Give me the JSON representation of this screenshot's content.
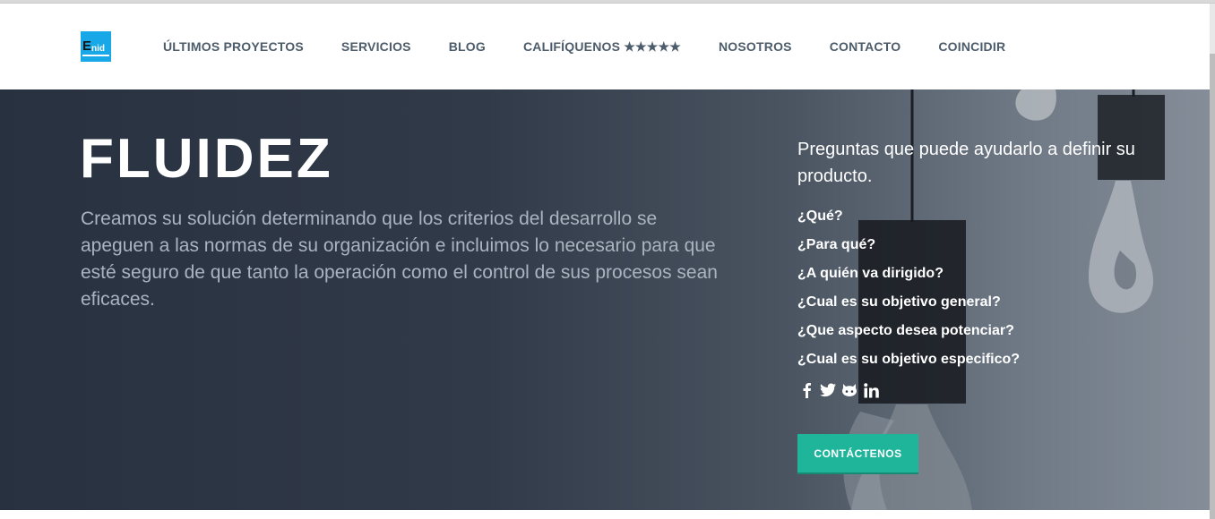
{
  "brand": {
    "logo_big": "E",
    "logo_small": "nid",
    "logo_color": "#18a8e8"
  },
  "nav": {
    "items": [
      {
        "label": "ÚLTIMOS PROYECTOS"
      },
      {
        "label": "SERVICIOS"
      },
      {
        "label": "BLOG"
      },
      {
        "label": "CALIFÍQUENOS ★★★★★"
      },
      {
        "label": "NOSOTROS"
      },
      {
        "label": "CONTACTO"
      },
      {
        "label": "COINCIDIR"
      }
    ]
  },
  "hero": {
    "title": "FLUIDEZ",
    "description": "Creamos su solución determinando que los criterios del desarrollo se apeguen a las normas de su organización e incluimos lo necesario para que esté seguro de que tanto la operación como el control de sus procesos sean eficaces.",
    "side_heading": "Preguntas que puede ayudarlo a definir su producto.",
    "questions": [
      "¿Qué?",
      "¿Para qué?",
      "¿A quién va dirigido?",
      "¿Cual es su objetivo general?",
      "¿Que aspecto desea potenciar?",
      "¿Cual es su objetivo especifico?"
    ],
    "social_icons": [
      "facebook-icon",
      "twitter-icon",
      "github-icon",
      "linkedin-icon"
    ],
    "cta_label": "CONTÁCTENOS",
    "cta_color": "#1fb59a"
  }
}
